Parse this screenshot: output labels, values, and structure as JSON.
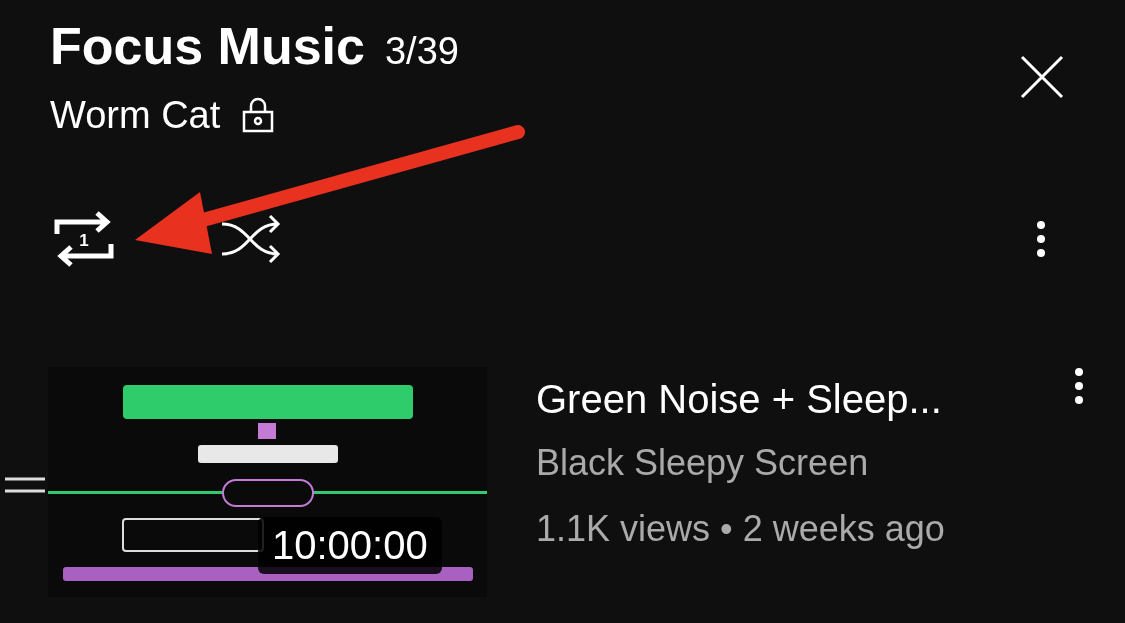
{
  "header": {
    "title": "Focus Music",
    "position": "3/39",
    "channel": "Worm Cat"
  },
  "controls": {
    "repeat_label": "1"
  },
  "videos": [
    {
      "title": "Green Noise + Sleep...",
      "channel": "Black Sleepy Screen",
      "meta": "1.1K views • 2 weeks ago",
      "duration": "10:00:00",
      "kind": "picture"
    }
  ]
}
